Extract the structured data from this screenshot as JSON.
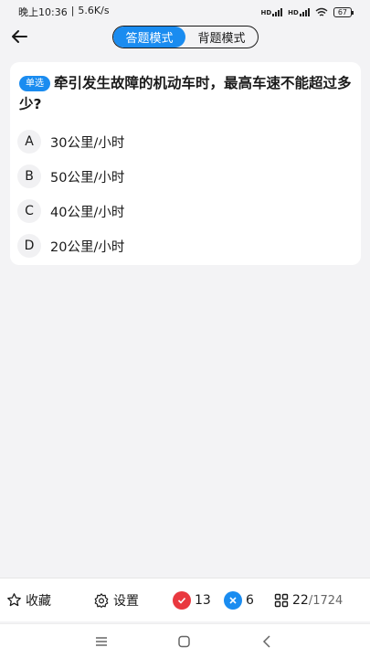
{
  "status": {
    "time": "晚上10:36",
    "speed": "5.6K/s",
    "network1": "HD",
    "network2": "HD",
    "battery": "67"
  },
  "header": {
    "tabs": [
      {
        "label": "答题模式",
        "active": true
      },
      {
        "label": "背题模式",
        "active": false
      }
    ]
  },
  "question": {
    "type_tag": "单选",
    "text": "牵引发生故障的机动车时，最高车速不能超过多少?",
    "options": [
      {
        "letter": "A",
        "text": "30公里/小时"
      },
      {
        "letter": "B",
        "text": "50公里/小时"
      },
      {
        "letter": "C",
        "text": "40公里/小时"
      },
      {
        "letter": "D",
        "text": "20公里/小时"
      }
    ]
  },
  "bottom": {
    "favorite_label": "收藏",
    "settings_label": "设置",
    "correct_count": "13",
    "wrong_count": "6",
    "progress_current": "22",
    "progress_total": "/1724"
  },
  "colors": {
    "accent": "#1a8cf0",
    "correct": "#e9383f",
    "wrong": "#1a8cf0"
  }
}
